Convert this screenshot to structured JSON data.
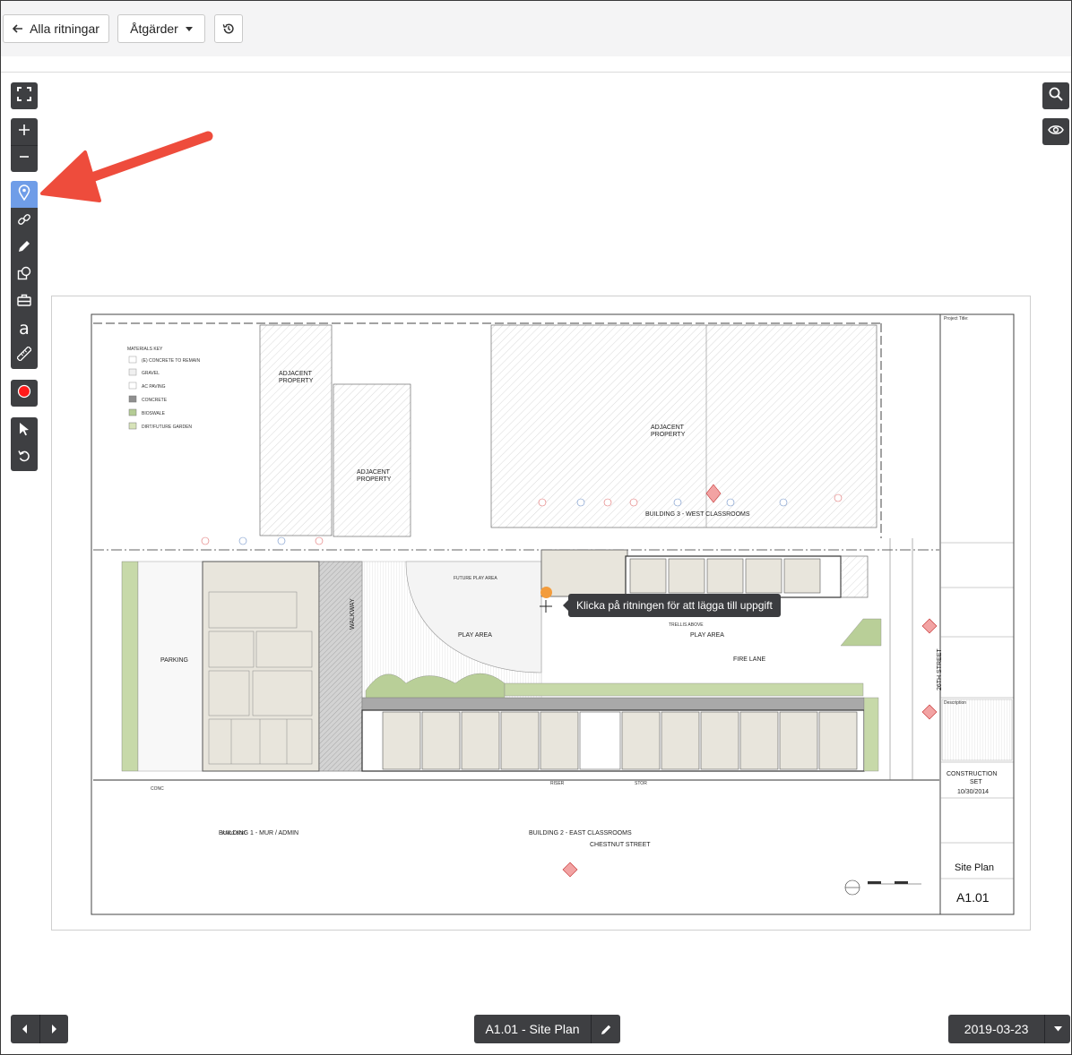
{
  "header": {
    "back_label": "Alla ritningar",
    "actions_label": "Åtgärder",
    "history_icon": "history-icon"
  },
  "toolbar": {
    "tools": [
      {
        "name": "fullscreen",
        "icon": "fullscreen-icon"
      },
      {
        "name": "zoom-in",
        "icon": "plus-icon"
      },
      {
        "name": "zoom-out",
        "icon": "minus-icon"
      },
      {
        "name": "add-task-pin",
        "icon": "map-pin-icon",
        "active": true
      },
      {
        "name": "link",
        "icon": "link-icon"
      },
      {
        "name": "pen",
        "icon": "pencil-icon"
      },
      {
        "name": "shapes",
        "icon": "shapes-icon"
      },
      {
        "name": "toolbox",
        "icon": "toolbox-icon"
      },
      {
        "name": "text",
        "icon": "text-icon",
        "glyph": "a"
      },
      {
        "name": "measure",
        "icon": "ruler-icon"
      },
      {
        "name": "record",
        "icon": "record-icon"
      },
      {
        "name": "select",
        "icon": "cursor-icon"
      },
      {
        "name": "undo",
        "icon": "undo-icon"
      }
    ],
    "right_tools": [
      {
        "name": "search",
        "icon": "search-icon"
      },
      {
        "name": "visibility",
        "icon": "eye-icon"
      }
    ]
  },
  "tooltip": {
    "text": "Klicka på ritningen för att lägga till uppgift"
  },
  "drawing": {
    "materials_key_title": "MATERIALS KEY",
    "materials": [
      "(E) CONCRETE TO REMAIN",
      "GRAVEL",
      "AC PAVING",
      "CONCRETE",
      "BIOSWALE",
      "DIRT/FUTURE GARDEN"
    ],
    "labels": {
      "adjacent_1": "ADJACENT",
      "adjacent_2": "PROPERTY",
      "building3": "BUILDING 3 - WEST CLASSROOMS",
      "building1": "BUILDING 1 - MUR / ADMIN",
      "building2": "BUILDING 2 - EAST CLASSROOMS",
      "parking": "PARKING",
      "walkway": "WALKWAY",
      "play_area": "PLAY AREA",
      "fire_lane": "FIRE LANE",
      "chestnut": "CHESTNUT STREET",
      "street26": "26TH STREET",
      "trellis": "TRELLIS ABOVE",
      "future_play": "FUTURE PLAY AREA",
      "knox_box": "KNOX BOX",
      "riser": "RISER",
      "stor": "STOR",
      "conc": "CONC"
    },
    "title_block": {
      "issue": "CONSTRUCTION",
      "issue2": "SET",
      "date": "10/30/2014",
      "sheet_title": "Site Plan",
      "sheet_number": "A1.01",
      "project_title_label": "Project Title:",
      "description_label": "Description"
    }
  },
  "footer": {
    "sheet_label": "A1.01 - Site Plan",
    "date_label": "2019-03-23"
  },
  "colors": {
    "toolbar_bg": "#3e3f42",
    "active_tool": "#6f9de8",
    "annotation_arrow": "#ee4c3c",
    "pin": "#f39c3c",
    "record": "#ff1a1a"
  }
}
